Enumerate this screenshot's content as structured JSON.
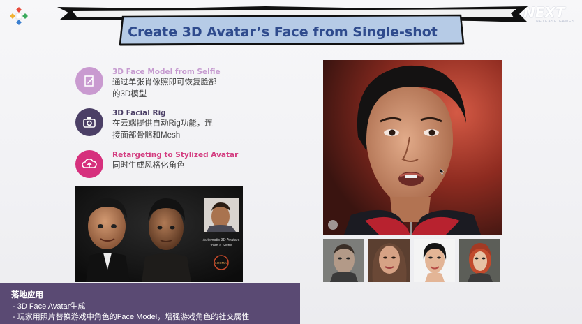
{
  "title": "Create 3D Avatar’s Face from Single-shot",
  "logo_right": {
    "word": "NEXT",
    "sub": "NETEASE GAMES"
  },
  "features": [
    {
      "head": "3D Face Model from Selfie",
      "desc_lines": [
        "通过单张肖像照即可恢复脸部",
        "的3D模型"
      ],
      "icon": "edit-document-icon",
      "color": "#c99ad0",
      "head_color": "#c69bd0"
    },
    {
      "head": "3D Facial Rig",
      "desc_lines": [
        "在云端提供自动Rig功能，连",
        "接面部骨骼和Mesh"
      ],
      "icon": "camera-icon",
      "color": "#4b3f66",
      "head_color": "#4b3f66"
    },
    {
      "head": "Retargeting to Stylized Avatar",
      "desc_lines": [
        "同时生成风格化角色"
      ],
      "icon": "cloud-upload-icon",
      "color": "#d6307d",
      "head_color": "#d33b7f"
    }
  ],
  "video": {
    "caption_lines": [
      "Automatic 3D Avatars",
      "from a Selfie"
    ],
    "badge": "LOOMAI"
  },
  "bottom": {
    "title": "落地应用",
    "lines": [
      "-    3D Face Avatar生成",
      "-    玩家用照片替换游戏中角色的Face Model，增强游戏角色的社交属性"
    ]
  }
}
